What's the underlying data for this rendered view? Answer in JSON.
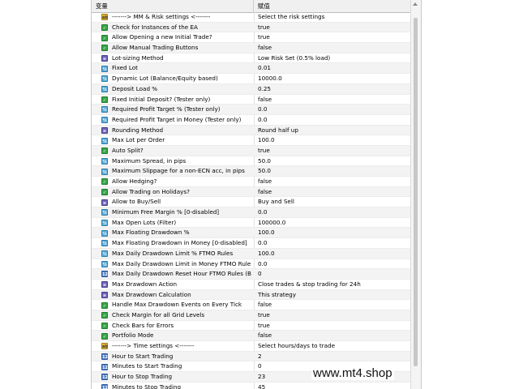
{
  "header": {
    "col_variable": "变量",
    "col_value": "赋值"
  },
  "rows": [
    {
      "icon": "str",
      "name": "-------> MM & Risk settings <-------",
      "value": "Select the risk settings"
    },
    {
      "icon": "bool",
      "name": "Check for Instances of the EA",
      "value": "true"
    },
    {
      "icon": "bool",
      "name": "Allow Opening a new Initial Trade?",
      "value": "true"
    },
    {
      "icon": "bool",
      "name": "Allow Manual Trading Buttons",
      "value": "false"
    },
    {
      "icon": "enum",
      "name": "Lot-sizing Method",
      "value": "Low Risk Set (0.5% load)"
    },
    {
      "icon": "dbl",
      "name": "Fixed Lot",
      "value": "0.01"
    },
    {
      "icon": "dbl",
      "name": "Dynamic Lot (Balance/Equity based)",
      "value": "10000.0"
    },
    {
      "icon": "dbl",
      "name": "Deposit Load %",
      "value": "0.25"
    },
    {
      "icon": "bool",
      "name": "Fixed Initial Deposit? (Tester only)",
      "value": "false"
    },
    {
      "icon": "dbl",
      "name": "Required Profit Target % (Tester only)",
      "value": "0.0"
    },
    {
      "icon": "dbl",
      "name": "Required Profit Target in Money (Tester only)",
      "value": "0.0"
    },
    {
      "icon": "enum",
      "name": "Rounding Method",
      "value": "Round half up"
    },
    {
      "icon": "dbl",
      "name": "Max Lot per Order",
      "value": "100.0"
    },
    {
      "icon": "bool",
      "name": "Auto Split?",
      "value": "true"
    },
    {
      "icon": "dbl",
      "name": "Maximum Spread, in pips",
      "value": "50.0"
    },
    {
      "icon": "dbl",
      "name": "Maximum Slippage for a non-ECN acc, in pips",
      "value": "50.0"
    },
    {
      "icon": "bool",
      "name": "Allow Hedging?",
      "value": "false"
    },
    {
      "icon": "bool",
      "name": "Allow Trading on Holidays?",
      "value": "false"
    },
    {
      "icon": "enum",
      "name": "Allow to Buy/Sell",
      "value": "Buy and Sell"
    },
    {
      "icon": "dbl",
      "name": "Minimum Free Margin % [0-disabled]",
      "value": "0.0"
    },
    {
      "icon": "dbl",
      "name": "Max Open Lots (Filter)",
      "value": "100000.0"
    },
    {
      "icon": "dbl",
      "name": "Max Floating Drawdown %",
      "value": "100.0"
    },
    {
      "icon": "dbl",
      "name": "Max Floating Drawdown in Money [0-disabled]",
      "value": "0.0"
    },
    {
      "icon": "dbl",
      "name": "Max Daily Drawdown Limit % FTMO Rules",
      "value": "100.0"
    },
    {
      "icon": "dbl",
      "name": "Max Daily Drawdown Limit in Money FTMO Rule...",
      "value": "0.0"
    },
    {
      "icon": "num",
      "name": "Max Daily Drawdown Reset Hour FTMO Rules (B...",
      "value": "0"
    },
    {
      "icon": "enum",
      "name": "Max Drawdown Action",
      "value": "Close trades & stop trading for 24h"
    },
    {
      "icon": "enum",
      "name": "Max Drawdown Calculation",
      "value": "This strategy"
    },
    {
      "icon": "bool",
      "name": "Handle Max Drawdown Events on Every Tick",
      "value": "false"
    },
    {
      "icon": "bool",
      "name": "Check Margin for all Grid Levels",
      "value": "true"
    },
    {
      "icon": "bool",
      "name": "Check Bars for Errors",
      "value": "true"
    },
    {
      "icon": "bool",
      "name": "Portfolio Mode",
      "value": "false"
    },
    {
      "icon": "str",
      "name": "-------> Time settings <-------",
      "value": "Select hours/days to trade"
    },
    {
      "icon": "num",
      "name": "Hour to Start Trading",
      "value": "2"
    },
    {
      "icon": "num",
      "name": "Minutes to Start Trading",
      "value": "0"
    },
    {
      "icon": "num",
      "name": "Hour to Stop Trading",
      "value": "23"
    },
    {
      "icon": "num",
      "name": "Minutes to Stop Trading",
      "value": "45"
    }
  ],
  "icon_labels": {
    "bool": "✓",
    "num": "123",
    "enum": "≡",
    "str": "ab",
    "dbl": "½"
  },
  "watermark": "www.mt4.shop"
}
